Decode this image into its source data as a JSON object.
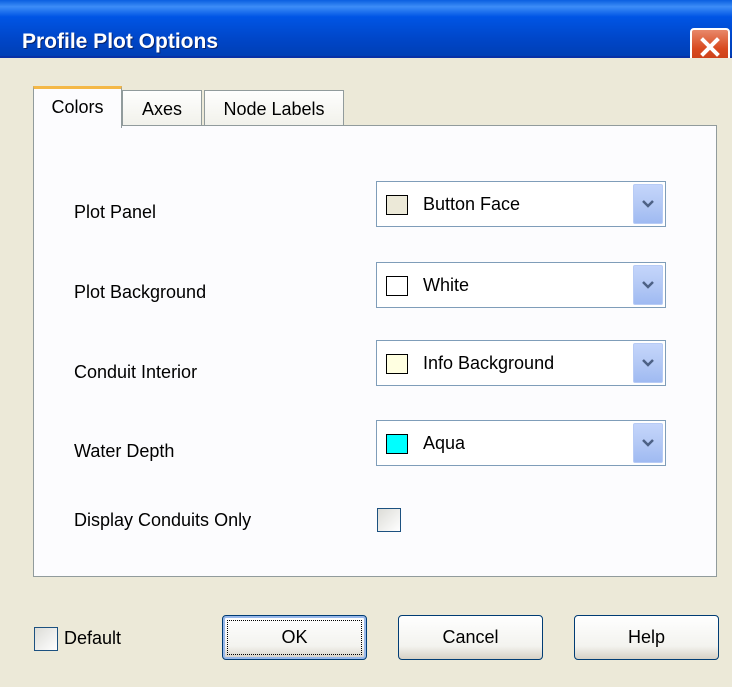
{
  "window": {
    "title": "Profile Plot Options"
  },
  "tabs": [
    {
      "label": "Colors",
      "active": true
    },
    {
      "label": "Axes",
      "active": false
    },
    {
      "label": "Node Labels",
      "active": false
    }
  ],
  "colors": {
    "plot_panel": {
      "label": "Plot Panel",
      "value": "Button Face",
      "swatch": "#ece9d8"
    },
    "plot_background": {
      "label": "Plot Background",
      "value": "White",
      "swatch": "#ffffff"
    },
    "conduit_interior": {
      "label": "Conduit Interior",
      "value": "Info Background",
      "swatch": "#ffffe1"
    },
    "water_depth": {
      "label": "Water Depth",
      "value": "Aqua",
      "swatch": "#00ffff"
    },
    "display_conduits_only": {
      "label": "Display Conduits Only",
      "checked": false
    }
  },
  "footer": {
    "default_label": "Default",
    "default_checked": false,
    "ok_label": "OK",
    "cancel_label": "Cancel",
    "help_label": "Help"
  }
}
